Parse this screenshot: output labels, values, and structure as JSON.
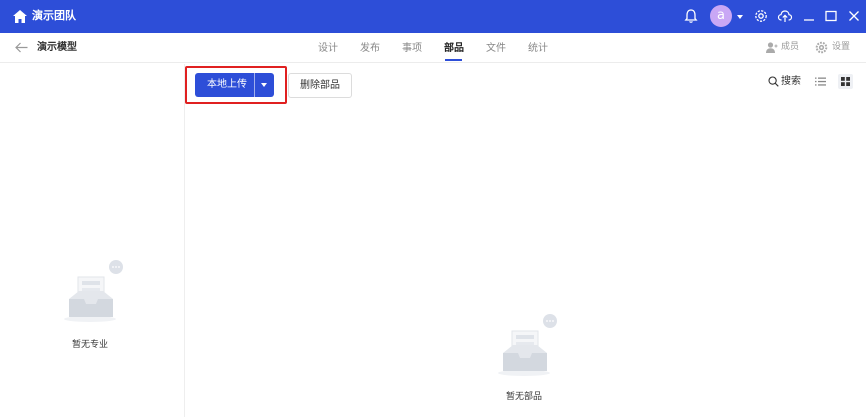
{
  "titlebar": {
    "team_name": "演示团队",
    "avatar_letter": "a",
    "bg_color": "#2d4ed8",
    "icons": [
      "home-icon",
      "bell-icon",
      "settings-icon",
      "cloud-upload-icon",
      "minimize-icon",
      "maximize-icon",
      "close-icon"
    ]
  },
  "nav": {
    "model_name": "演示模型",
    "tabs": [
      {
        "label": "设计",
        "active": false
      },
      {
        "label": "发布",
        "active": false
      },
      {
        "label": "事项",
        "active": false
      },
      {
        "label": "部品",
        "active": true
      },
      {
        "label": "文件",
        "active": false
      },
      {
        "label": "统计",
        "active": false
      }
    ],
    "members_label": "成员",
    "settings_label": "设置"
  },
  "left_panel": {
    "empty_text": "暂无专业"
  },
  "toolbar": {
    "upload_label": "本地上传",
    "delete_label": "删除部品",
    "search_label": "搜索",
    "active_view": "grid"
  },
  "main": {
    "empty_text": "暂无部品"
  },
  "colors": {
    "accent": "#2d4ed8",
    "highlight": "#e02020"
  }
}
